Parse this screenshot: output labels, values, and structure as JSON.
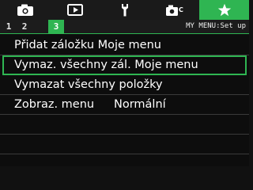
{
  "tabs": [
    {
      "icon": "camera-icon"
    },
    {
      "icon": "playback-icon"
    },
    {
      "icon": "wrench-icon"
    },
    {
      "icon": "custom-camera-icon"
    },
    {
      "icon": "star-icon",
      "active": true
    }
  ],
  "subtabs": [
    "1",
    "2",
    "3"
  ],
  "active_subtab": "3",
  "tab_title": "MY MENU:Set up",
  "menu": {
    "add_tab": "Přidat záložku Moje menu",
    "delete_all_tabs": "Vymaz. všechny zál. Moje menu",
    "delete_all_items": "Vymazat všechny položky",
    "display_menu_label": "Zobraz. menu",
    "display_menu_value": "Normální"
  },
  "colors": {
    "accent": "#2fb552",
    "background": "#0d0d0d"
  }
}
